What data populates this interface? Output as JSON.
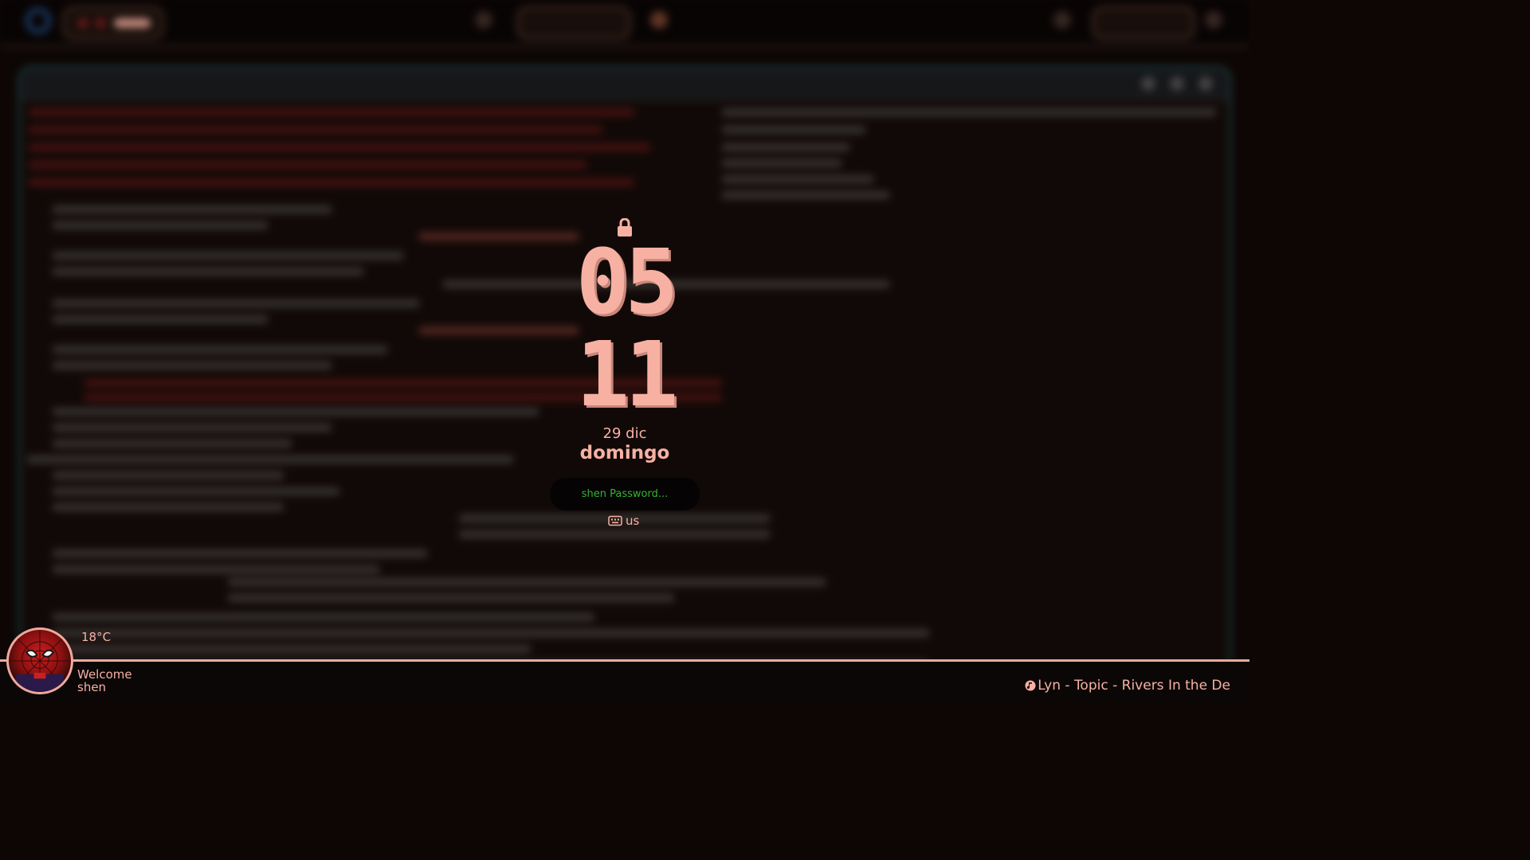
{
  "lock_screen": {
    "clock_hour": "05",
    "clock_minute": "11",
    "date": "29 dic",
    "weekday": "domingo",
    "password_placeholder": "shen Password...",
    "keyboard_layout": "us"
  },
  "status": {
    "temperature": "18°C",
    "welcome_line1": "Welcome",
    "welcome_line2": "shen",
    "now_playing": "Lyn - Topic - Rivers In the De"
  },
  "colors": {
    "accent": "#f7b1a3",
    "password_text": "#36b235",
    "background": "#0d0605"
  },
  "icons": {
    "lock": "lock-icon",
    "keyboard": "keyboard-icon",
    "music": "music-note-icon",
    "avatar": "spiderman-avatar"
  }
}
